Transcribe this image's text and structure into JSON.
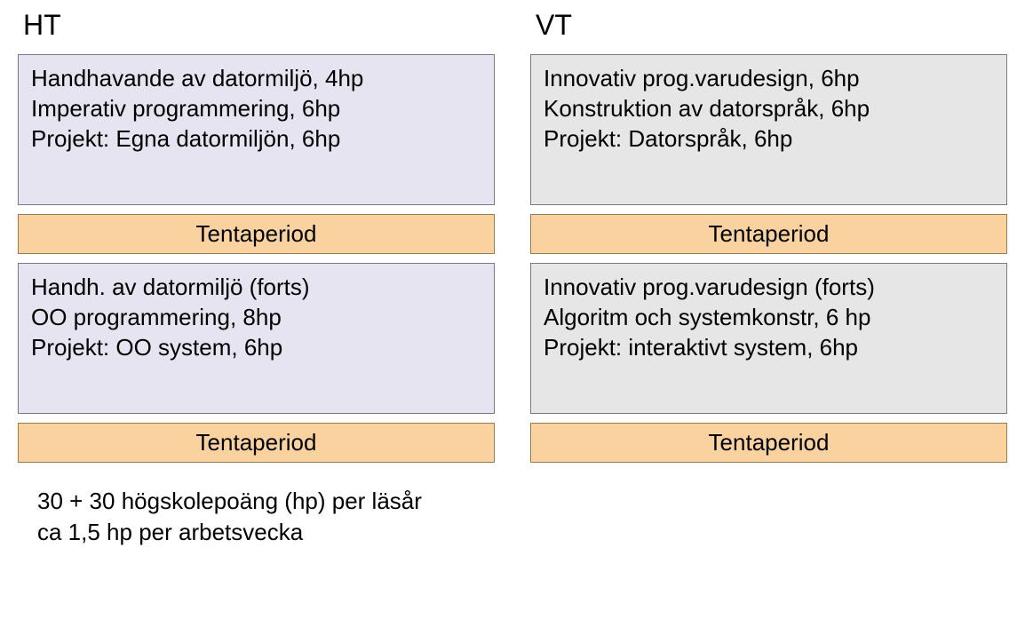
{
  "ht": {
    "label": "HT",
    "block1": {
      "lines": [
        "Handhavande av datormiljö, 4hp",
        "Imperativ programmering, 6hp",
        "Projekt: Egna datormiljön, 6hp"
      ]
    },
    "tenta1": "Tentaperiod",
    "block2": {
      "lines": [
        "Handh. av datormiljö (forts)",
        "OO programmering, 8hp",
        "Projekt: OO system, 6hp"
      ]
    },
    "tenta2": "Tentaperiod"
  },
  "vt": {
    "label": "VT",
    "block1": {
      "lines": [
        "Innovativ prog.varudesign, 6hp",
        "Konstruktion av datorspråk, 6hp",
        "Projekt: Datorspråk, 6hp"
      ]
    },
    "tenta1": "Tentaperiod",
    "block2": {
      "lines": [
        "Innovativ prog.varudesign (forts)",
        "Algoritm och systemkonstr, 6 hp",
        "Projekt: interaktivt system, 6hp"
      ]
    },
    "tenta2": "Tentaperiod"
  },
  "footer": {
    "line1": "30 + 30 högskolepoäng (hp) per läsår",
    "line2": "ca 1,5 hp per arbetsvecka"
  }
}
